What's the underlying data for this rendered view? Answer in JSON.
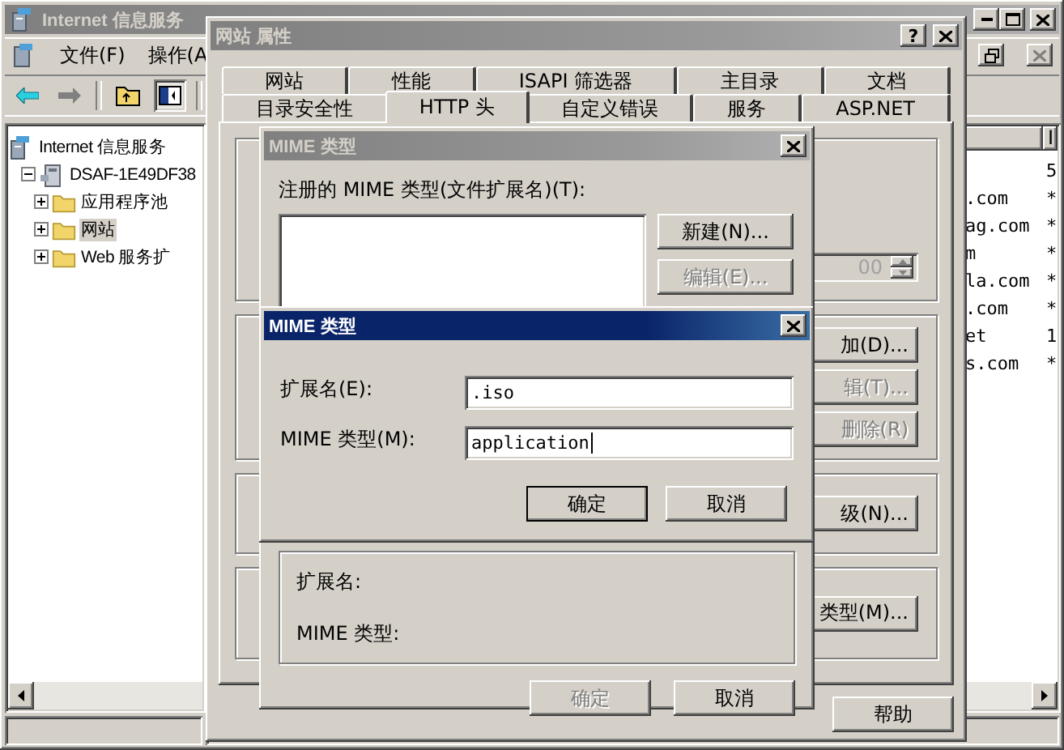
{
  "main_window": {
    "title": "Internet 信息服务",
    "active": false,
    "menu": [
      "文件(F)",
      "操作(A"
    ],
    "tree": [
      {
        "label": "Internet 信息服务",
        "selected": false,
        "kind": "root",
        "children": [
          {
            "label": "DSAF-1E49DF38",
            "expanded": true,
            "selected": false,
            "kind": "server",
            "children": [
              {
                "label": "应用程序池",
                "expanded": false,
                "selected": false,
                "kind": "folder"
              },
              {
                "label": "网站",
                "expanded": false,
                "selected": true,
                "kind": "folder"
              },
              {
                "label": "Web 服务扩",
                "expanded": false,
                "selected": false,
                "kind": "folder"
              }
            ]
          }
        ]
      }
    ],
    "list": {
      "columns": [
        "I"
      ],
      "rows": [
        {
          "column_1": "",
          "column_2": "5"
        },
        {
          "column_1": ".com",
          "column_2": "*"
        },
        {
          "column_1": "ag.com",
          "column_2": "*"
        },
        {
          "column_1": "m",
          "column_2": "*"
        },
        {
          "column_1": "la.com",
          "column_2": "*"
        },
        {
          "column_1": ".com",
          "column_2": "*"
        },
        {
          "column_1": "et",
          "column_2": "1"
        },
        {
          "column_1": "s.com",
          "column_2": "*"
        }
      ]
    }
  },
  "properties_dialog": {
    "title": "网站 属性",
    "active": false,
    "help_button": "?",
    "tab_rows": [
      {
        "tabs": [
          {
            "label": "网站",
            "selected": false
          },
          {
            "label": "性能",
            "selected": false
          },
          {
            "label": "ISAPI 筛选器",
            "selected": false
          },
          {
            "label": "主目录",
            "selected": false
          },
          {
            "label": "文档",
            "selected": false
          }
        ]
      },
      {
        "tabs": [
          {
            "label": "目录安全性",
            "selected": false
          },
          {
            "label": "HTTP 头",
            "selected": true
          },
          {
            "label": "自定义错误",
            "selected": false
          },
          {
            "label": "服务",
            "selected": false
          },
          {
            "label": "ASP.NET",
            "selected": false
          }
        ]
      }
    ],
    "groups": [
      {
        "kind": "spinner",
        "value": "00",
        "disabled": true
      },
      {
        "kind": "buttons",
        "buttons": [
          {
            "label": "加(D)...",
            "disabled": false
          },
          {
            "label": "辑(T)...",
            "disabled": true
          },
          {
            "label": "删除(R)",
            "disabled": true
          }
        ]
      },
      {
        "kind": "buttons",
        "buttons": [
          {
            "label": "级(N)...",
            "disabled": false
          }
        ]
      },
      {
        "kind": "buttons",
        "buttons": [
          {
            "label": "类型(M)...",
            "disabled": false
          }
        ]
      }
    ],
    "footer_buttons": [
      {
        "label": "帮助",
        "disabled": false
      }
    ]
  },
  "mime_list_dialog": {
    "title": "MIME 类型",
    "active": false,
    "list_label": "注册的 MIME 类型(文件扩展名)(T):",
    "side_buttons": [
      {
        "label": "新建(N)...",
        "disabled": false
      },
      {
        "label": "编辑(E)...",
        "disabled": true
      }
    ],
    "details": [
      "扩展名:",
      "MIME 类型:"
    ],
    "footer_buttons": [
      {
        "label": "确定",
        "disabled": true
      },
      {
        "label": "取消",
        "disabled": false
      }
    ]
  },
  "mime_edit_dialog": {
    "title": "MIME 类型",
    "active": true,
    "fields": [
      {
        "label": "扩展名(E):",
        "value": ".iso",
        "focused": false
      },
      {
        "label": "MIME 类型(M):",
        "value": "application",
        "focused": true
      }
    ],
    "buttons": [
      {
        "label": "确定",
        "default": true
      },
      {
        "label": "取消",
        "default": false
      }
    ]
  }
}
